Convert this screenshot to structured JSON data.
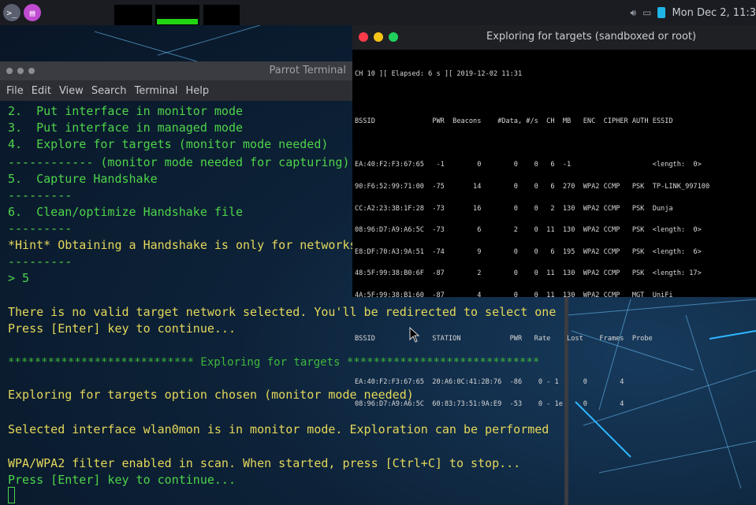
{
  "top_panel": {
    "terminal_icon": ">_",
    "clock": "Mon Dec 2, 11:3",
    "colors": {
      "panel": "#1a1c21",
      "battery": "#1fb4e6",
      "app_icon": "#c04bd0"
    }
  },
  "parrot_terminal": {
    "title": "Parrot Terminal",
    "menu": [
      "File",
      "Edit",
      "View",
      "Search",
      "Terminal",
      "Help"
    ]
  },
  "terminal_lines": [
    {
      "text": "2.  Put interface in monitor mode",
      "color": "green"
    },
    {
      "text": "3.  Put interface in managed mode",
      "color": "green"
    },
    {
      "text": "4.  Explore for targets (monitor mode needed)",
      "color": "green"
    },
    {
      "text": "------------ (monitor mode needed for capturing)",
      "color": "green"
    },
    {
      "text": "5.  Capture Handshake",
      "color": "green"
    },
    {
      "text": "---------",
      "color": "green"
    },
    {
      "text": "6.  Clean/optimize Handshake file",
      "color": "green"
    },
    {
      "text": "---------",
      "color": "green"
    },
    {
      "text": "*Hint* Obtaining a Handshake is only for networks",
      "color": "yellow"
    },
    {
      "text": "---------",
      "color": "green"
    },
    {
      "text": "> 5",
      "color": "green"
    },
    {
      "text": "There is no valid target network selected. You'll be redirected to select one",
      "color": "yellow"
    },
    {
      "text": "Press [Enter] key to continue...",
      "color": "yellow"
    },
    {
      "text": "**************************** Exploring for targets *****************************",
      "color": "green"
    },
    {
      "text": "Exploring for targets option chosen (monitor mode needed)",
      "color": "yellow"
    },
    {
      "text": "Selected interface wlan0mon is in monitor mode. Exploration can be performed",
      "color": "yellow"
    },
    {
      "text": "WPA/WPA2 filter enabled in scan. When started, press [Ctrl+C] to stop...",
      "color": "yellow"
    },
    {
      "text": "Press [Enter] key to continue...",
      "color": "green"
    }
  ],
  "airodump": {
    "title": "Exploring for targets (sandboxed or root)",
    "status": "CH 10 ][ Elapsed: 6 s ][ 2019-12-02 11:31",
    "ap_header": "BSSID              PWR  Beacons    #Data, #/s  CH  MB   ENC  CIPHER AUTH ESSID",
    "ap_rows": [
      "EA:40:F2:F3:67:65   -1        0        0    0   6  -1                    <length:  0>",
      "90:F6:52:99:71:00  -75       14        0    0   6  270  WPA2 CCMP   PSK  TP-LINK_997100",
      "CC:A2:23:3B:1F:28  -73       16        0    0   2  130  WPA2 CCMP   PSK  Dunja",
      "08:96:D7:A9:A6:5C  -73        6        2    0  11  130  WPA2 CCMP   PSK  <length:  0>",
      "E8:DF:70:A3:9A:51  -74        9        0    0   6  195  WPA2 CCMP   PSK  <length:  6>",
      "48:5F:99:38:B0:6F  -87        2        0    0  11  130  WPA2 CCMP   PSK  <length: 17>",
      "4A:5F:99:38:B1:60  -87        4        0    0  11  130  WPA2 CCMP   MGT  UniFi"
    ],
    "station_header": "BSSID              STATION            PWR   Rate    Lost    Frames  Probe",
    "station_rows": [
      "EA:40:F2:F3:67:65  20:A6:0C:41:2B:76  -86    0 - 1      0        4",
      "08:96:D7:A9:A6:5C  60:83:73:51:9A:E9  -53    0 - 1e     0        4"
    ]
  }
}
